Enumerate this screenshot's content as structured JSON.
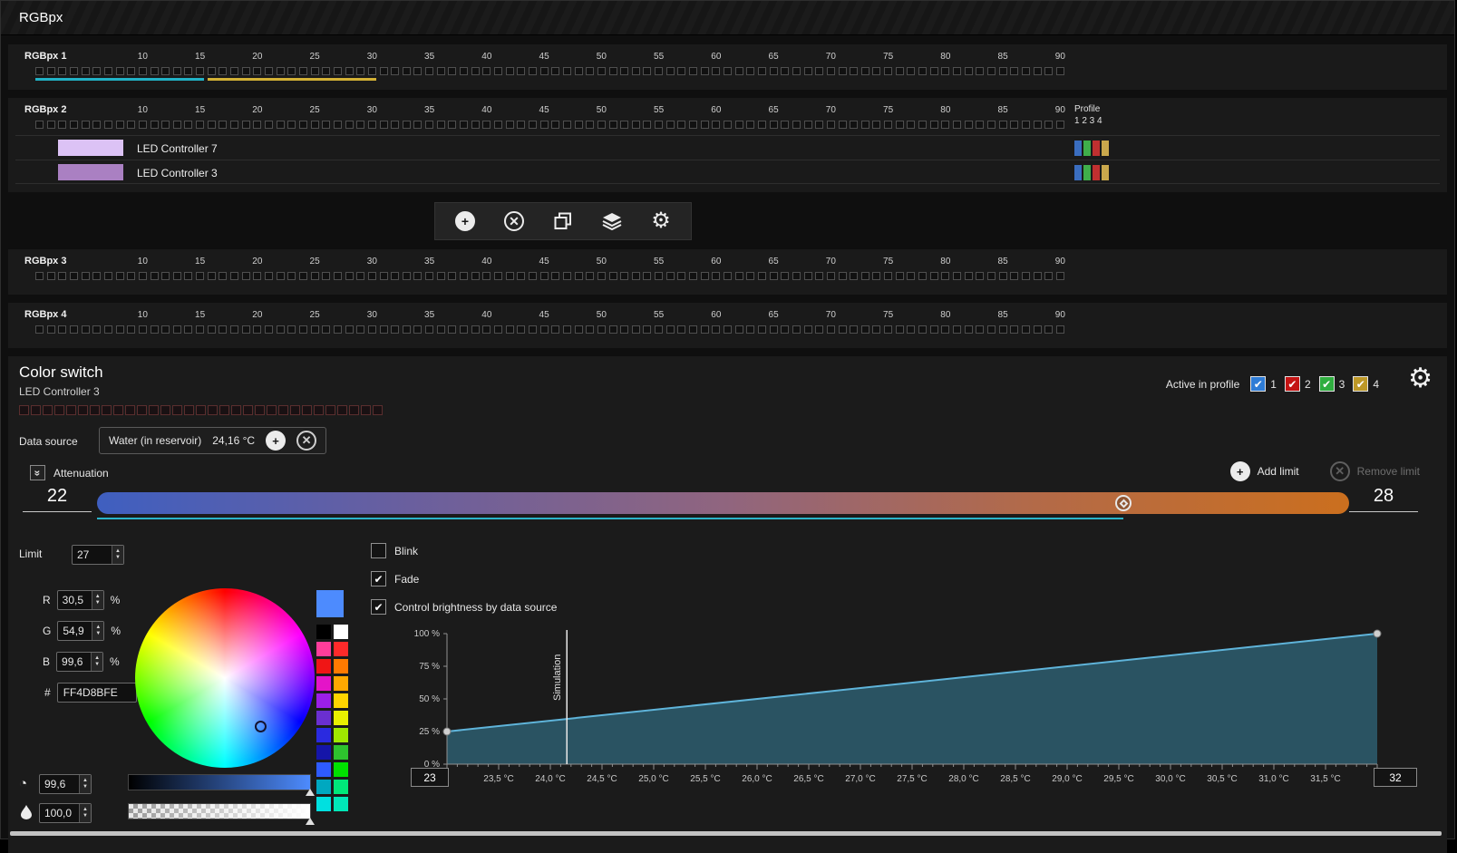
{
  "window": {
    "title": "RGBpx"
  },
  "strips": {
    "tick_start": 10,
    "tick_step": 5,
    "tick_end": 90,
    "items": [
      {
        "name": "RGBpx 1",
        "led_count": 90,
        "highlights": [
          {
            "color": "#21b2c6",
            "from": 1,
            "to": 15
          },
          {
            "color": "#d3b135",
            "from": 16,
            "to": 30
          }
        ]
      },
      {
        "name": "RGBpx 2",
        "led_count": 90,
        "profile_label": "Profile",
        "profile_numbers": "1 2 3 4",
        "controllers": [
          {
            "name": "LED Controller 7",
            "swatch": "#dcc2f5",
            "indicators": [
              "#3a6dbf",
              "#3fae4a",
              "#c03030",
              "#c9a84c"
            ]
          },
          {
            "name": "LED Controller 3",
            "swatch": "#aa80c2",
            "indicators": [
              "#3a6dbf",
              "#3fae4a",
              "#c03030",
              "#c9a84c"
            ]
          }
        ]
      },
      {
        "name": "RGBpx 3",
        "led_count": 90
      },
      {
        "name": "RGBpx 4",
        "led_count": 90
      }
    ]
  },
  "toolbar": {
    "buttons": [
      {
        "name": "add",
        "icon": "plus-circle"
      },
      {
        "name": "delete",
        "icon": "cross-circle"
      },
      {
        "name": "copy",
        "icon": "copy"
      },
      {
        "name": "layers",
        "icon": "layers"
      },
      {
        "name": "settings",
        "icon": "gear"
      }
    ]
  },
  "color_switch": {
    "title": "Color switch",
    "subtitle": "LED Controller 3",
    "preview_count": 31,
    "active_in_profile_label": "Active in profile",
    "profiles": [
      {
        "num": "1",
        "color": "#2e7cd6",
        "checked": true
      },
      {
        "num": "2",
        "color": "#c41414",
        "checked": true
      },
      {
        "num": "3",
        "color": "#2fae3f",
        "checked": true
      },
      {
        "num": "4",
        "color": "#bd9827",
        "checked": true
      }
    ],
    "data_source": {
      "label": "Data source",
      "name": "Water (in reservoir)",
      "value": "24,16 °C"
    },
    "attenuation_label": "Attenuation",
    "add_limit_label": "Add limit",
    "remove_limit_label": "Remove limit",
    "range": {
      "min": "22",
      "max": "28",
      "handle": 0.82,
      "gradient": [
        "#3f5fc0",
        "#6a5f9e",
        "#90657f",
        "#b36a48",
        "#cb6f1e"
      ],
      "progress_color": "#2ab3c9"
    },
    "limit": {
      "label": "Limit",
      "value": "27"
    },
    "rgb": {
      "r": {
        "label": "R",
        "value": "30,5"
      },
      "g": {
        "label": "G",
        "value": "54,9"
      },
      "b": {
        "label": "B",
        "value": "99,6"
      },
      "unit": "%"
    },
    "hex": {
      "label": "#",
      "value": "FF4D8BFE"
    },
    "current_color": "#4D8BFE",
    "brightness": {
      "value": "99,6"
    },
    "opacity": {
      "value": "100,0"
    },
    "palette": [
      [
        "#000000",
        "#ffffff"
      ],
      [
        "#ff3d9a",
        "#ff2a2a"
      ],
      [
        "#f01515",
        "#ff7a00"
      ],
      [
        "#e414c8",
        "#ffa800"
      ],
      [
        "#9b1fe8",
        "#ffd400"
      ],
      [
        "#6a2fd0",
        "#e8f000"
      ],
      [
        "#2a2ae0",
        "#9fe800"
      ],
      [
        "#1515a8",
        "#2ec22e"
      ],
      [
        "#2e5bff",
        "#00e000"
      ],
      [
        "#00a8c0",
        "#00e87a"
      ],
      [
        "#00e0e0",
        "#00e8b8"
      ]
    ],
    "options": [
      {
        "label": "Blink",
        "checked": false
      },
      {
        "label": "Fade",
        "checked": true
      },
      {
        "label": "Control brightness by data source",
        "checked": true
      }
    ]
  },
  "chart_data": {
    "type": "area",
    "series": [
      {
        "name": "brightness",
        "x": [
          23,
          32
        ],
        "y": [
          25,
          100
        ]
      }
    ],
    "xlim": [
      23,
      32
    ],
    "ylim": [
      0,
      100
    ],
    "x_tick_labels": [
      "23,5 °C",
      "24,0 °C",
      "24,5 °C",
      "25,0 °C",
      "25,5 °C",
      "26,0 °C",
      "26,5 °C",
      "27,0 °C",
      "27,5 °C",
      "28,0 °C",
      "28,5 °C",
      "29,0 °C",
      "29,5 °C",
      "30,0 °C",
      "30,5 °C",
      "31,0 °C",
      "31,5 °C"
    ],
    "x_tick_first": 23.5,
    "x_tick_step": 0.5,
    "x_minor_step": 0.1,
    "y_tick_values": [
      0,
      25,
      50,
      75,
      100
    ],
    "y_tick_labels": [
      "0 %",
      "25 %",
      "50 %",
      "75 %",
      "100 %"
    ],
    "simulation": {
      "x": 24.16,
      "label": "Simulation"
    },
    "min_input": "23",
    "max_input": "32",
    "line_color": "#5fb4da",
    "fill_color": "#2a5362",
    "marker_color": "#cfcfcf",
    "axis_color": "#909090",
    "legend": "none",
    "grid": false
  }
}
